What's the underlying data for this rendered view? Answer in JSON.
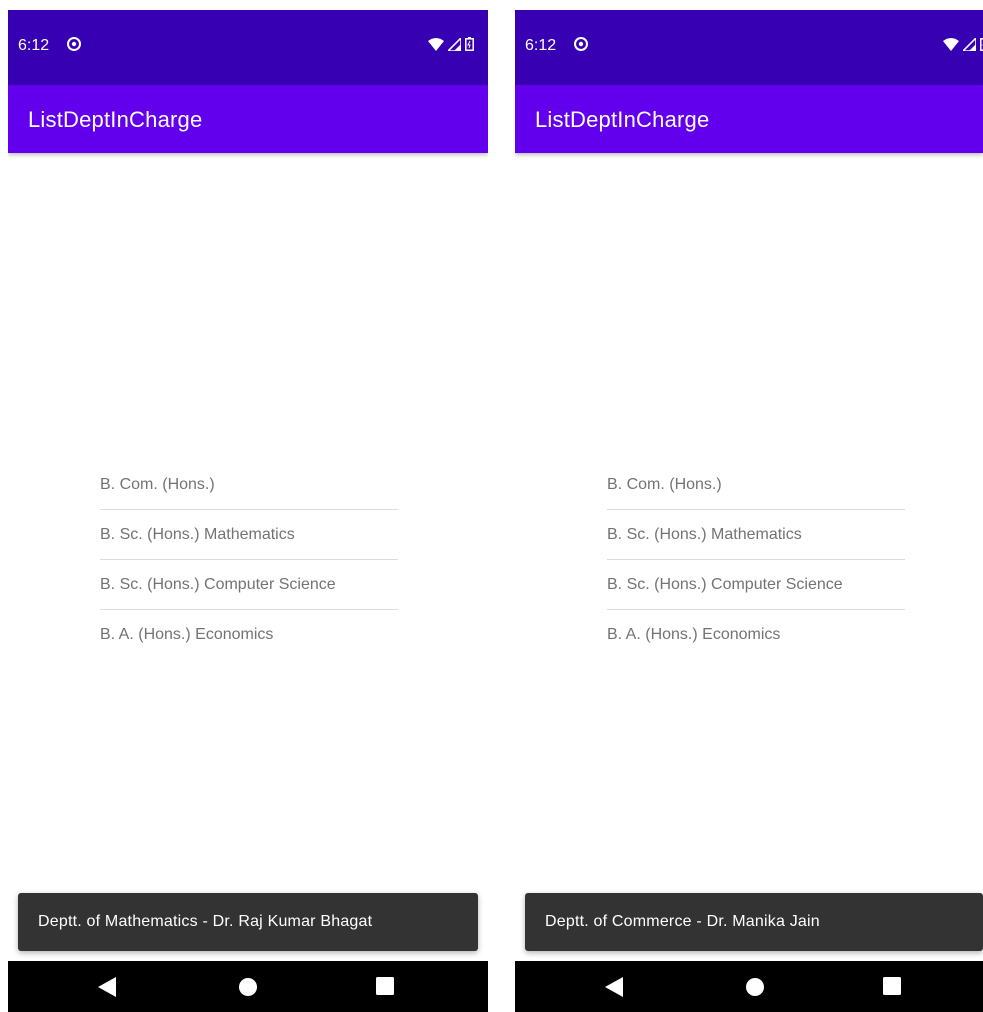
{
  "screens": [
    {
      "status_time": "6:12",
      "app_title": "ListDeptInCharge",
      "departments": [
        "B. Com. (Hons.)",
        "B. Sc. (Hons.) Mathematics",
        "B. Sc. (Hons.) Computer Science",
        "B. A. (Hons.) Economics"
      ],
      "toast_text": "Deptt. of Mathematics - Dr. Raj Kumar Bhagat"
    },
    {
      "status_time": "6:12",
      "app_title": "ListDeptInCharge",
      "departments": [
        "B. Com. (Hons.)",
        "B. Sc. (Hons.) Mathematics",
        "B. Sc. (Hons.) Computer Science",
        "B. A. (Hons.) Economics"
      ],
      "toast_text": "Deptt. of Commerce - Dr. Manika Jain"
    }
  ],
  "icons": {
    "status_left": "sync-icon",
    "status_right": [
      "wifi-icon",
      "cell-signal-icon",
      "battery-icon"
    ],
    "nav": [
      "back-icon",
      "home-icon",
      "recents-icon"
    ]
  },
  "colors": {
    "status_bar": "#3700b3",
    "app_bar": "#6200ee",
    "toast": "#333333",
    "nav_bar": "#000000",
    "list_text": "#737373"
  }
}
